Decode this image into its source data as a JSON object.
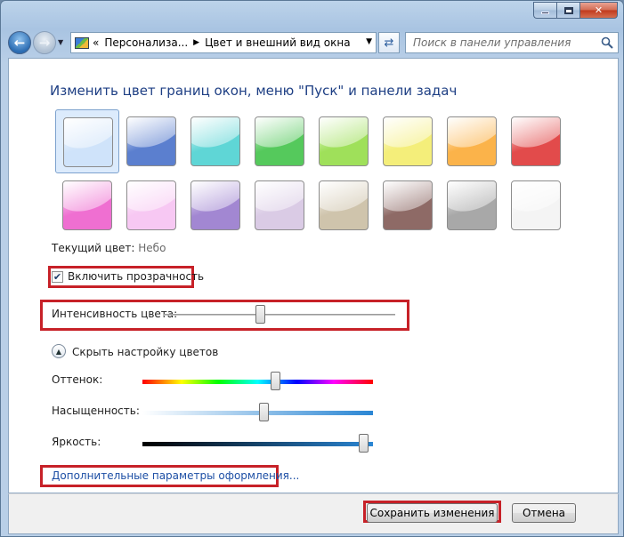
{
  "window": {
    "caption": {
      "minimize": "–",
      "maximize": "□",
      "close": "✕"
    }
  },
  "nav": {
    "address_parts": [
      "«",
      "Персонализа...",
      "Цвет и внешний вид окна"
    ],
    "search_placeholder": "Поиск в панели управления"
  },
  "main": {
    "heading": "Изменить цвет границ окон, меню \"Пуск\" и панели задач",
    "swatches": [
      {
        "name": "sky",
        "color": "#cfe3fa",
        "selected": true
      },
      {
        "name": "twilight",
        "color": "#5b7fcf"
      },
      {
        "name": "sea",
        "color": "#5fd6d6"
      },
      {
        "name": "leaf",
        "color": "#55c95c"
      },
      {
        "name": "lime",
        "color": "#9fe05a"
      },
      {
        "name": "sun",
        "color": "#f4ee7a"
      },
      {
        "name": "pumpkin",
        "color": "#fbb34a"
      },
      {
        "name": "ruby",
        "color": "#e24b4b"
      },
      {
        "name": "fuchsia",
        "color": "#ef6fd1"
      },
      {
        "name": "blush",
        "color": "#f7c8f3"
      },
      {
        "name": "violet",
        "color": "#a287d2"
      },
      {
        "name": "lavender",
        "color": "#dacbe5"
      },
      {
        "name": "taupe",
        "color": "#cfc4ac"
      },
      {
        "name": "chocolate",
        "color": "#8e6a66"
      },
      {
        "name": "slate",
        "color": "#a8a8a8"
      },
      {
        "name": "frost",
        "color": "#f4f4f4"
      }
    ],
    "current_label": "Текущий цвет:",
    "current_value": "Небо",
    "transparency_label": "Включить прозрачность",
    "transparency_checked": true,
    "intensity_label": "Интенсивность цвета:",
    "intensity_value": 0.42,
    "toggle_label": "Скрыть настройку цветов",
    "hue_label": "Оттенок:",
    "hue_value": 0.58,
    "saturation_label": "Насыщенность:",
    "saturation_value": 0.53,
    "brightness_label": "Яркость:",
    "brightness_value": 0.96,
    "advanced_link": "Дополнительные параметры оформления..."
  },
  "footer": {
    "save_label": "Сохранить изменения",
    "cancel_label": "Отмена"
  },
  "colors": {
    "highlight": "#c72128",
    "heading": "#1e3f84",
    "link": "#1d4fa5"
  }
}
